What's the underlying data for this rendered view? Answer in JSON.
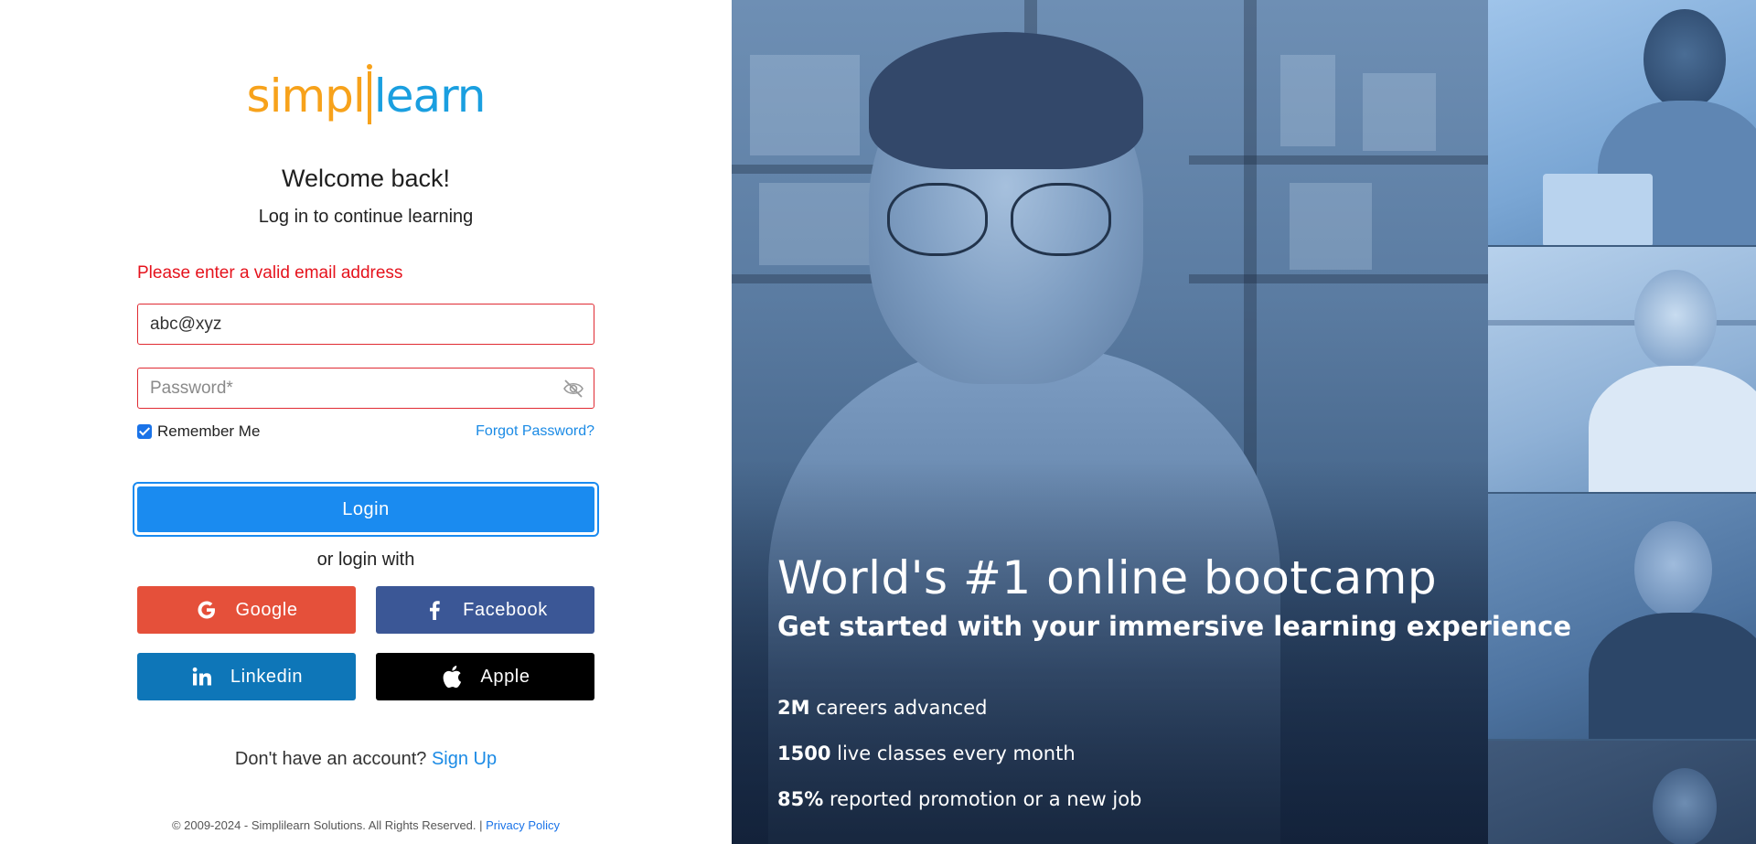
{
  "brand": {
    "logo_part1": "simpl",
    "logo_part2": "learn"
  },
  "login": {
    "heading": "Welcome back!",
    "subheading": "Log in to continue learning",
    "error_message": "Please enter a valid email address",
    "email_value": "abc@xyz",
    "password_placeholder": "Password*",
    "remember_label": "Remember Me",
    "remember_checked": true,
    "forgot_label": "Forgot Password?",
    "login_label": "Login",
    "or_text": "or login with",
    "social": {
      "google": "Google",
      "facebook": "Facebook",
      "linkedin": "Linkedin",
      "apple": "Apple"
    },
    "signup_prompt": "Don't have an account?",
    "signup_link": "Sign Up"
  },
  "footer": {
    "copyright": "© 2009-2024 - Simplilearn Solutions. All Rights Reserved. |",
    "privacy_link": "Privacy Policy"
  },
  "promo": {
    "headline": "World's #1 online bootcamp",
    "tagline": "Get started with your immersive learning experience",
    "stats": [
      {
        "value": "2M",
        "text": "careers advanced"
      },
      {
        "value": "1500",
        "text": "live classes every month"
      },
      {
        "value": "85%",
        "text": "reported promotion or a new job"
      }
    ]
  },
  "colors": {
    "brand_orange": "#f7a21b",
    "brand_blue": "#1a9fe0",
    "error_red": "#e5131d",
    "login_blue": "#1a8bf0",
    "google": "#e5503a",
    "facebook": "#3b5796",
    "linkedin": "#0e76b8",
    "apple": "#000000"
  },
  "icons": [
    "eye-off-icon",
    "checkbox-checked-icon",
    "google-icon",
    "facebook-icon",
    "linkedin-icon",
    "apple-icon"
  ]
}
